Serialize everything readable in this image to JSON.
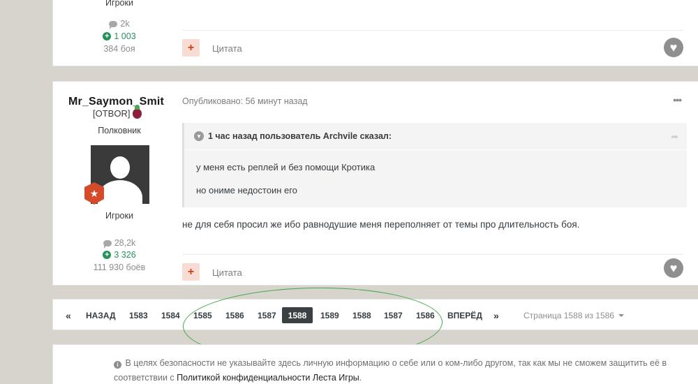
{
  "prev_post": {
    "group": "Игроки",
    "posts_count": "2k",
    "reputation": "1 003",
    "battles": "384 боя",
    "quote_label": "Цитата"
  },
  "post": {
    "author": "Mr_Saymon_Smit",
    "clan_tag": "[OTBOR]",
    "rank": "Полковник",
    "group": "Игроки",
    "posts_count": "28,2k",
    "reputation": "3 326",
    "battles": "111 930 боёв",
    "posted": "Опубликовано: 56 минут назад",
    "more_label": "•••",
    "quote": {
      "header": "1 час назад пользователь Archvile сказал:",
      "lines": [
        "у меня есть реплей и без помощи Кротика",
        "но ониме недостоин его"
      ]
    },
    "text": "не для себя просил же ибо равнодушие меня переполняет от темы про длительность боя.",
    "quote_label": "Цитата"
  },
  "pagination": {
    "first": "«",
    "prev": "НАЗАД",
    "pages": [
      "1583",
      "1584",
      "1585",
      "1586",
      "1587",
      "1588",
      "1589",
      "1588",
      "1587",
      "1586"
    ],
    "active_index": 5,
    "next": "ВПЕРЁД",
    "last": "»",
    "info": "Страница 1588 из 1586"
  },
  "notice": {
    "text_before": "В целях безопасности не указывайте здесь личную информацию о себе или о ком-либо другом, так как мы не сможем защитить её в соответствии с ",
    "link": "Политикой конфиденциальности Леста Игры",
    "text_after": "."
  },
  "colors": {
    "background": "#d6d4cc",
    "accent_red": "#d33d1b",
    "reputation_green": "#27915b",
    "active_page": "#3b4043",
    "annotation_green": "#3ea548"
  }
}
